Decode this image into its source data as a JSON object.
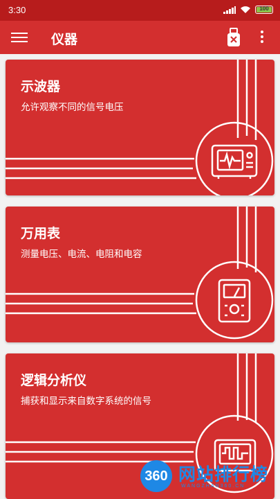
{
  "status_bar": {
    "time": "3:30",
    "battery_level": "100",
    "icons": [
      "signal-icon",
      "wifi-icon",
      "battery-icon"
    ]
  },
  "app_bar": {
    "title": "仪器",
    "icons": [
      "hamburger-menu-icon",
      "usb-device-icon",
      "more-vertical-icon"
    ]
  },
  "instruments": [
    {
      "title": "示波器",
      "subtitle": "允许观察不同的信号电压",
      "icon": "oscilloscope-icon"
    },
    {
      "title": "万用表",
      "subtitle": "测量电压、电流、电阻和电容",
      "icon": "multimeter-icon"
    },
    {
      "title": "逻辑分析仪",
      "subtitle": "捕获和显示来自数字系统的信号",
      "icon": "logic-analyzer-icon"
    }
  ],
  "watermark": {
    "logo_text": "360",
    "site_name": "网站排行榜",
    "domain": "WANGZHAN360.CN"
  },
  "colors": {
    "status_bar": "#b71c1c",
    "app_bar": "#d32f2f",
    "card": "#d32f2f",
    "background": "#f2f2f2",
    "watermark": "#1e88e5"
  }
}
